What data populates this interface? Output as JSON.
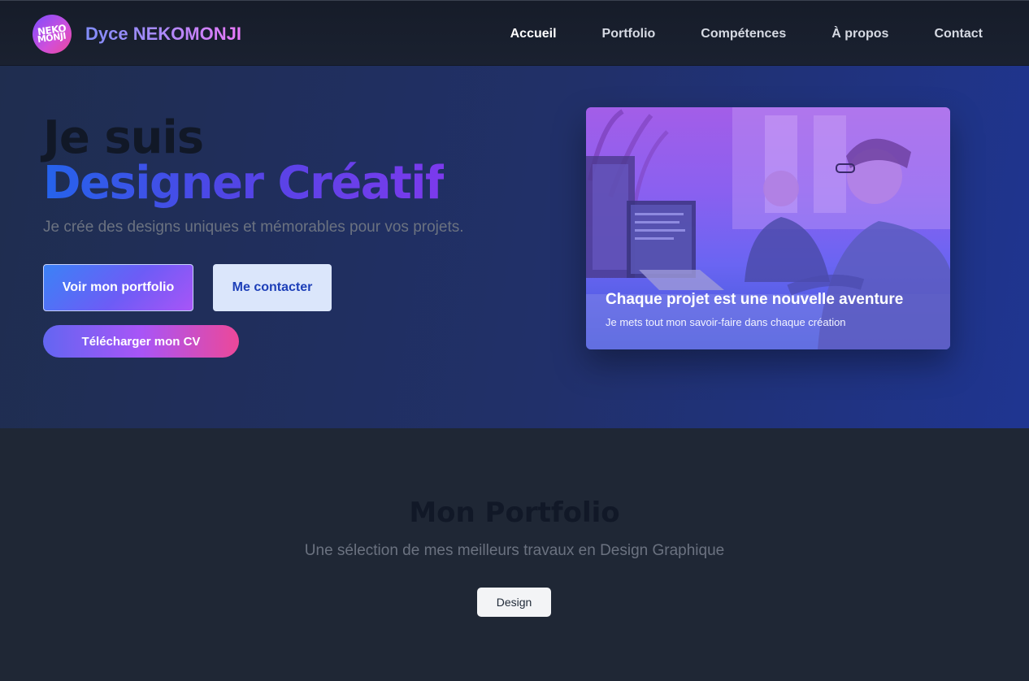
{
  "nav": {
    "logo_text_top": "NEKO",
    "logo_text_bottom": "MONJI",
    "brand": "Dyce NEKOMONJI",
    "links": [
      {
        "label": "Accueil"
      },
      {
        "label": "Portfolio"
      },
      {
        "label": "Compétences"
      },
      {
        "label": "À propos"
      },
      {
        "label": "Contact"
      }
    ]
  },
  "hero": {
    "title_line1": "Je suis",
    "title_line2": "Designer Créatif",
    "subtitle": "Je crée des designs uniques et mémorables pour vos projets.",
    "buttons": {
      "portfolio": "Voir mon portfolio",
      "contact": "Me contacter",
      "cv": "Télécharger mon CV"
    },
    "card": {
      "title": "Chaque projet est une nouvelle aventure",
      "subtitle": "Je mets tout mon savoir-faire dans chaque création"
    }
  },
  "portfolio": {
    "title": "Mon Portfolio",
    "subtitle": "Une sélection de mes meilleurs travaux en Design Graphique",
    "filter": "Design"
  },
  "colors": {
    "accent_blue": "#2563eb",
    "accent_purple": "#7c3aed",
    "accent_pink": "#ec4899",
    "page_bg": "#1f2735"
  }
}
